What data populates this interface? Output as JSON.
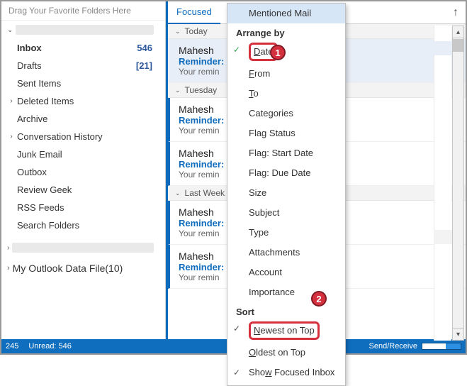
{
  "sidebar": {
    "drag_hint": "Drag Your Favorite Folders Here",
    "folders": [
      {
        "name": "Inbox",
        "count": "546",
        "selected": true
      },
      {
        "name": "Drafts",
        "count": "[21]"
      },
      {
        "name": "Sent Items"
      },
      {
        "name": "Deleted Items",
        "chev": true
      },
      {
        "name": "Archive"
      },
      {
        "name": "Conversation History",
        "chev": true
      },
      {
        "name": "Junk Email"
      },
      {
        "name": "Outbox"
      },
      {
        "name": "Review Geek"
      },
      {
        "name": "RSS Feeds"
      },
      {
        "name": "Search Folders"
      }
    ],
    "outlook_data": "My Outlook Data File(10)"
  },
  "msglist": {
    "tab_focused": "Focused",
    "sort_arrow": "↑",
    "groups": [
      {
        "label": "Today",
        "items": [
          {
            "from": "Mahesh",
            "subj": "Reminder:",
            "prev": "Your remin",
            "sel": true
          }
        ]
      },
      {
        "label": "Tuesday",
        "items": [
          {
            "from": "Mahesh",
            "subj": "Reminder:",
            "prev": "Your remin",
            "unread": true
          },
          {
            "from": "Mahesh",
            "subj": "Reminder:",
            "prev": "Your remin",
            "unread": true
          }
        ]
      },
      {
        "label": "Last Week",
        "items": [
          {
            "from": "Mahesh",
            "subj": "Reminder:",
            "prev": "Your remin",
            "unread": true
          },
          {
            "from": "Mahesh",
            "subj": "Reminder:",
            "prev": "Your remin",
            "unread": true
          }
        ]
      }
    ]
  },
  "menu": {
    "mentioned": "Mentioned Mail",
    "arrange_by": "Arrange by",
    "items": [
      "Date",
      "From",
      "To",
      "Categories",
      "Flag Status",
      "Flag: Start Date",
      "Flag: Due Date",
      "Size",
      "Subject",
      "Type",
      "Attachments",
      "Account",
      "Importance"
    ],
    "sort": "Sort",
    "sort_items": [
      "Newest on Top",
      "Oldest on Top"
    ],
    "show_focused": "Show Focused Inbox"
  },
  "callouts": {
    "one": "1",
    "two": "2"
  },
  "status": {
    "left": "245",
    "unread": "Unread: 546",
    "sr": "Send/Receive"
  }
}
